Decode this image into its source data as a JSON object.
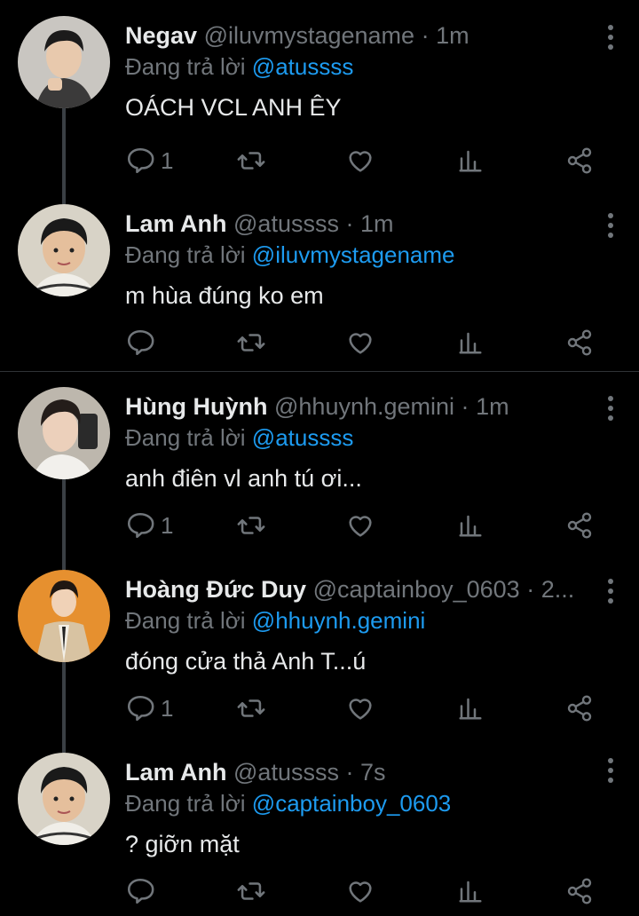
{
  "reply_prefix": "Đang trả lời",
  "colors": {
    "background": "#000000",
    "text": "#e7e9ea",
    "muted": "#71767b",
    "link": "#1d9bf0",
    "thread_line": "#3a3f44"
  },
  "tweets": [
    {
      "name": "Negav",
      "handle": "@iluvmystagename",
      "time": "1m",
      "reply_to": "@atussss",
      "text": "OÁCH VCL ANH ÊY",
      "reply_count": "1",
      "avatar": "avatar-negav"
    },
    {
      "name": "Lam Anh",
      "handle": "@atussss",
      "time": "1m",
      "reply_to": "@iluvmystagename",
      "text": "m hùa đúng ko em",
      "reply_count": "",
      "avatar": "avatar-lam-anh"
    },
    {
      "name": "Hùng Huỳnh",
      "handle": "@hhuynh.gemini",
      "time": "1m",
      "reply_to": "@atussss",
      "text": "anh điên vl anh tú ơi...",
      "reply_count": "1",
      "avatar": "avatar-hung-huynh"
    },
    {
      "name": "Hoàng Đức Duy",
      "handle": "@captainboy_0603",
      "time": "2...",
      "reply_to": "@hhuynh.gemini",
      "text": "đóng cửa thả Anh T...ú",
      "reply_count": "1",
      "avatar": "avatar-hoang-duc-duy"
    },
    {
      "name": "Lam Anh",
      "handle": "@atussss",
      "time": "7s",
      "reply_to": "@captainboy_0603",
      "text": "? giỡn mặt",
      "reply_count": "",
      "avatar": "avatar-lam-anh"
    }
  ],
  "icons": [
    "reply-icon",
    "retweet-icon",
    "like-icon",
    "analytics-icon",
    "share-icon",
    "more-icon"
  ]
}
